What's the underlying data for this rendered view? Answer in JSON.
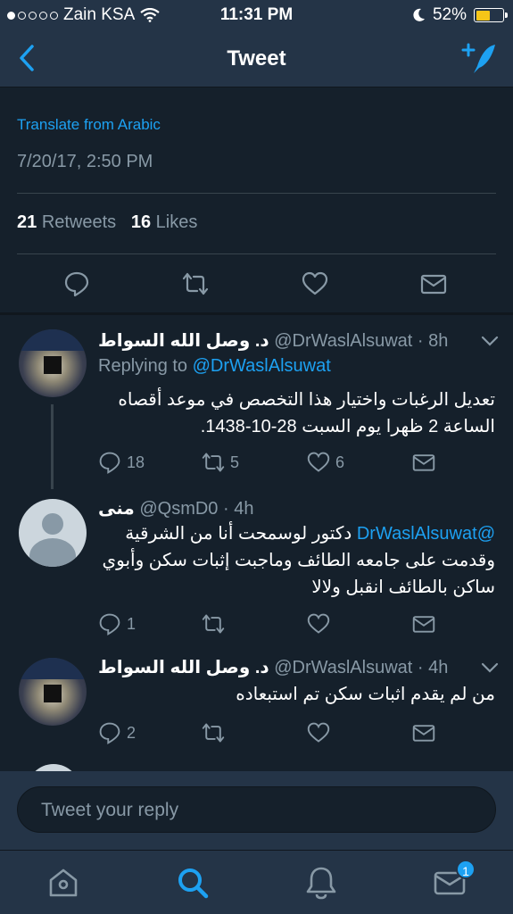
{
  "status_bar": {
    "carrier": "Zain KSA",
    "time": "11:31 PM",
    "battery": "52%",
    "battery_level": 0.52
  },
  "nav": {
    "title": "Tweet",
    "back_icon": "chevron-left-icon",
    "compose_icon": "compose-tweet-icon"
  },
  "tweet": {
    "translate_label": "Translate from Arabic",
    "timestamp": "7/20/17, 2:50 PM",
    "retweets_count": "21",
    "retweets_label": "Retweets",
    "likes_count": "16",
    "likes_label": "Likes"
  },
  "replies": [
    {
      "name": "د. وصل الله السواط",
      "meta": "@DrWaslAlsuwat · 8h",
      "replying_prefix": "Replying to",
      "replying_to": "@DrWaslAlsuwat",
      "text": "تعديل الرغبات واختيار هذا التخصص في موعد أقصاه الساعة 2 ظهرا يوم السبت 28-10-1438.",
      "replies": "18",
      "retweets": "5",
      "likes": "6"
    },
    {
      "name": "منى",
      "meta": "@QsmD0 · 4h",
      "mention": "@DrWaslAlsuwat",
      "text": "دكتور لوسمحت أنا من الشرقية وقدمت على جامعه الطائف وماجبت إثبات سكن وأبوي ساكن بالطائف انقبل ولالا",
      "replies": "1",
      "retweets": "",
      "likes": ""
    },
    {
      "name": "د. وصل الله السواط",
      "meta": "@DrWaslAlsuwat · 4h",
      "text": "من لم يقدم اثبات سكن تم استبعاده",
      "replies": "2",
      "retweets": "",
      "likes": ""
    }
  ],
  "reply_bar": {
    "placeholder": "Tweet your reply"
  },
  "tabs": {
    "home": "home-icon",
    "search": "search-icon",
    "notifications": "bell-icon",
    "messages": "mail-icon",
    "messages_badge": "1"
  },
  "colors": {
    "background": "#15202b",
    "bar": "#243447",
    "accent": "#1da1f2",
    "muted": "#8899a6"
  }
}
